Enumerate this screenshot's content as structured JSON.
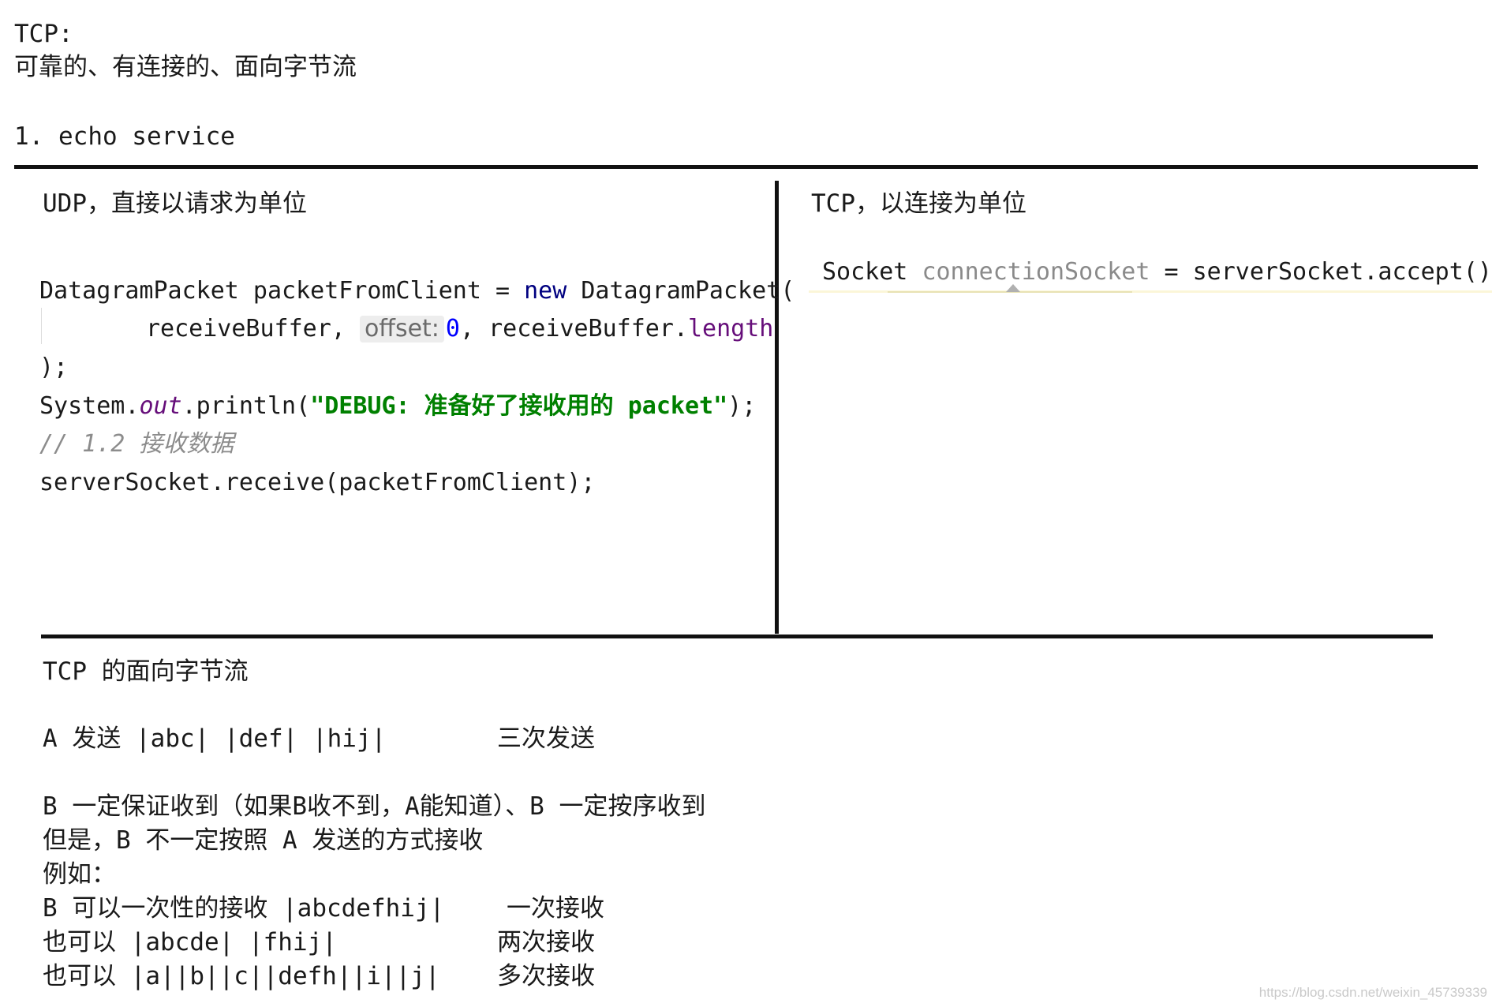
{
  "header": {
    "title": "TCP:",
    "subtitle": "可靠的、有连接的、面向字节流",
    "section": "1. echo service"
  },
  "udp": {
    "heading": "UDP，直接以请求为单位",
    "line1": {
      "type": "DatagramPacket",
      "var": " packetFromClient = ",
      "kw": "new",
      "ctor": " DatagramPacket("
    },
    "line2": {
      "arg1": "receiveBuffer, ",
      "hint_label": "offset:",
      "hint_value": "0",
      "comma": ", ",
      "obj": "receiveBuffer.",
      "field": "length"
    },
    "line3": ");",
    "line4": {
      "prefix": "System.",
      "out": "out",
      "method": ".println(",
      "string": "\"DEBUG: 准备好了接收用的 packet\"",
      "suffix": ");"
    },
    "comment": "// 1.2 接收数据",
    "line6": "serverSocket.receive(packetFromClient);"
  },
  "tcp": {
    "heading": "TCP，以连接为单位",
    "code": {
      "type": "Socket ",
      "var": "connectionSocket",
      "rest": " = serverSocket.accept();"
    }
  },
  "stream": {
    "heading": "TCP 的面向字节流",
    "send_line": "A 发送 |abc| |def| |hij|",
    "send_note": "三次发送",
    "guarantee": "B 一定保证收到（如果B收不到，A能知道）、B 一定按序收到",
    "but": "但是，B 不一定按照 A 发送的方式接收",
    "example": "例如：",
    "recv1": "B 可以一次性的接收 |abcdefhij|",
    "recv1_note": "一次接收",
    "recv2": "也可以 |abcde| |fhij|",
    "recv2_note": "两次接收",
    "recv3": "也可以 |a||b||c||defh||i||j|",
    "recv3_note": "多次接收"
  },
  "watermark": "https://blog.csdn.net/weixin_45739339"
}
